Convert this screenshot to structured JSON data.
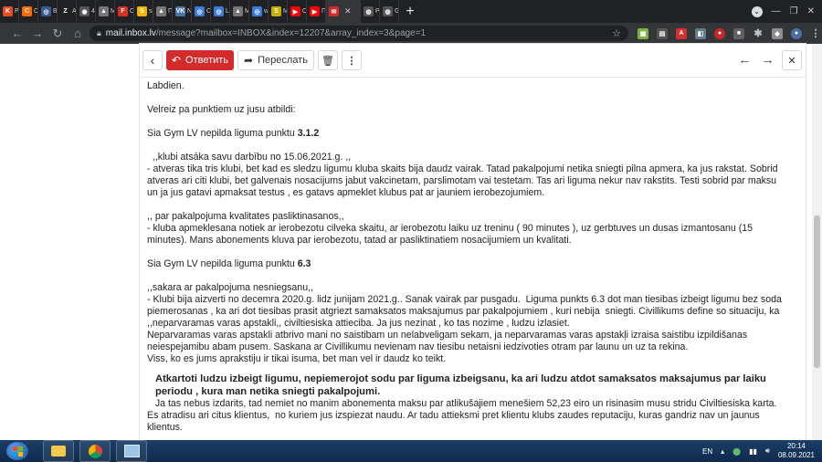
{
  "browser": {
    "tabs": [
      {
        "icon": "K",
        "label": "Pa",
        "color": "#e44d26"
      },
      {
        "icon": "C",
        "label": "Ce",
        "color": "#ff6a00"
      },
      {
        "icon": "◎",
        "label": "Be",
        "color": "#3b5998"
      },
      {
        "icon": "Z",
        "label": "Aj",
        "color": "#222222"
      },
      {
        "icon": "◉",
        "label": "40",
        "color": "#555555"
      },
      {
        "icon": "▲",
        "label": "Mi",
        "color": "#777777"
      },
      {
        "icon": "F",
        "label": "Cs",
        "color": "#d93025"
      },
      {
        "icon": "S",
        "label": "sai",
        "color": "#f4b400"
      },
      {
        "icon": "▲",
        "label": "Пс",
        "color": "#777777"
      },
      {
        "icon": "VK",
        "label": "Ne",
        "color": "#4a76a8"
      },
      {
        "icon": "◎",
        "label": "CC",
        "color": "#3b7bd6"
      },
      {
        "icon": "◎",
        "label": "Lö",
        "color": "#3b7bd6"
      },
      {
        "icon": "▲",
        "label": "M",
        "color": "#777777"
      },
      {
        "icon": "◎",
        "label": "wi",
        "color": "#3b7bd6"
      },
      {
        "icon": "S",
        "label": "M",
        "color": "#c0b000"
      },
      {
        "icon": "▶",
        "label": "Cy",
        "color": "#ff0000"
      },
      {
        "icon": "▶",
        "label": "Пс",
        "color": "#ff0000"
      },
      {
        "icon": "✉",
        "label": "",
        "color": "#d32b2b"
      },
      {
        "icon": "◍",
        "label": "Pi",
        "color": "#555555"
      },
      {
        "icon": "◍",
        "label": "Go",
        "color": "#555555"
      }
    ],
    "active_tab_index": 17,
    "new_tab_symbol": "+",
    "url_host": "mail.inbox.lv",
    "url_path": "/message?mailbox=INBOX&index=12207&array_index=3&page=1"
  },
  "mail": {
    "reply_label": "Ответить",
    "forward_label": "Переслать",
    "paragraphs": [
      {
        "type": "p",
        "text": "Labdien."
      },
      {
        "type": "gap"
      },
      {
        "type": "p",
        "text": "Velreiz pa punktiem uz jusu atbildi:"
      },
      {
        "type": "gap"
      },
      {
        "type": "pbold",
        "text": "Sia Gym LV nepilda liguma punktu ",
        "bold": "3.1.2"
      },
      {
        "type": "gap"
      },
      {
        "type": "p",
        "text": "  ,,klubi atsāka savu darbību no 15.06.2021.g. ,,"
      },
      {
        "type": "p",
        "text": "- atveras tika tris klubi, bet kad es sledzu ligumu kluba skaits bija daudz vairak. Tatad pakalpojumi netika sniegti pilna apmera, ka jus rakstat. Sobrid atveras ari citi klubi, bet galvenais nosacijums jabut vakcinetam, parslimotam vai testetam. Tas ari liguma nekur nav rakstits. Testi sobrid par maksu un ja jus gatavi apmaksat testus , es gatavs apmeklet klubus pat ar jauniem ierobezojumiem."
      },
      {
        "type": "gap"
      },
      {
        "type": "p",
        "text": ",, par pakalpojuma kvalitates pasliktinasanos,,"
      },
      {
        "type": "p",
        "text": "- kluba apmeklesana notiek ar ierobezotu cilveka skaitu, ar ierobezotu laiku uz treninu ( 90 minutes ), uz gerbtuves un dusas izmantosanu (15 minutes). Mans abonements kluva par ierobezotu, tatad ar pasliktinatiem nosacijumiem un kvalitati."
      },
      {
        "type": "gap"
      },
      {
        "type": "pbold",
        "text": "Sia Gym LV nepilda liguma punktu ",
        "bold": "6.3"
      },
      {
        "type": "gap"
      },
      {
        "type": "p",
        "text": ",,sakara ar pakalpojuma nesniegsanu,,"
      },
      {
        "type": "p",
        "text": "- Klubi bija aizverti no decemra 2020.g. lidz junijam 2021.g.. Sanak vairak par pusgadu.  Liguma punkts 6.3 dot man tiesibas izbeigt ligumu bez soda piemerosanas , ka ari dot tiesibas prasit atgriezt samaksatos maksajumus par pakalpojumiem , kuri nebija  sniegti. Civillikums define so situaciju, ka ,,neparvaramas varas apstakli,, civiltiesiska attieciba. Ja jus nezinat , ko tas nozime , ludzu izlasiet."
      },
      {
        "type": "p",
        "text": "Neparvaramas varas apstakli atbrivo mani no saistibam un nelabveligam sekam, ja neparvaramas varas apstakļi izraisa saistibu izpildišanas neiespejamibu abam pusem. Saskana ar Civillikumu nevienam nav tiesibu netaisni iedzivoties otram par launu un uz ta rekina."
      },
      {
        "type": "p",
        "text": "Viss, ko es jums aprakstiju ir tikai isuma, bet man vel ir daudz ko teikt."
      },
      {
        "type": "gaphalf"
      },
      {
        "type": "heading",
        "text": "Atkartoti ludzu izbeigt ligumu, nepiemerojot sodu par liguma izbeigsanu, ka ari ludzu atdot samaksatos maksajumus par laiku periodu , kura man netika sniegti pakalpojumi."
      },
      {
        "type": "p",
        "text": "   Ja tas nebus izdarits, tad nemiet no manim abonementa maksu par atlikušajiem menešiem 52,23 eiro un risinasim musu stridu Civiltiesiska karta. Es atradisu ari citus klientus,  no kuriem jus izspiezat naudu. Ar tadu attieksmi pret klientu klubs zaudes reputaciju, kuras gandriz nav un jaunus klientus."
      }
    ]
  },
  "taskbar": {
    "language": "EN",
    "time": "20:14",
    "date": "08.09.2021"
  }
}
